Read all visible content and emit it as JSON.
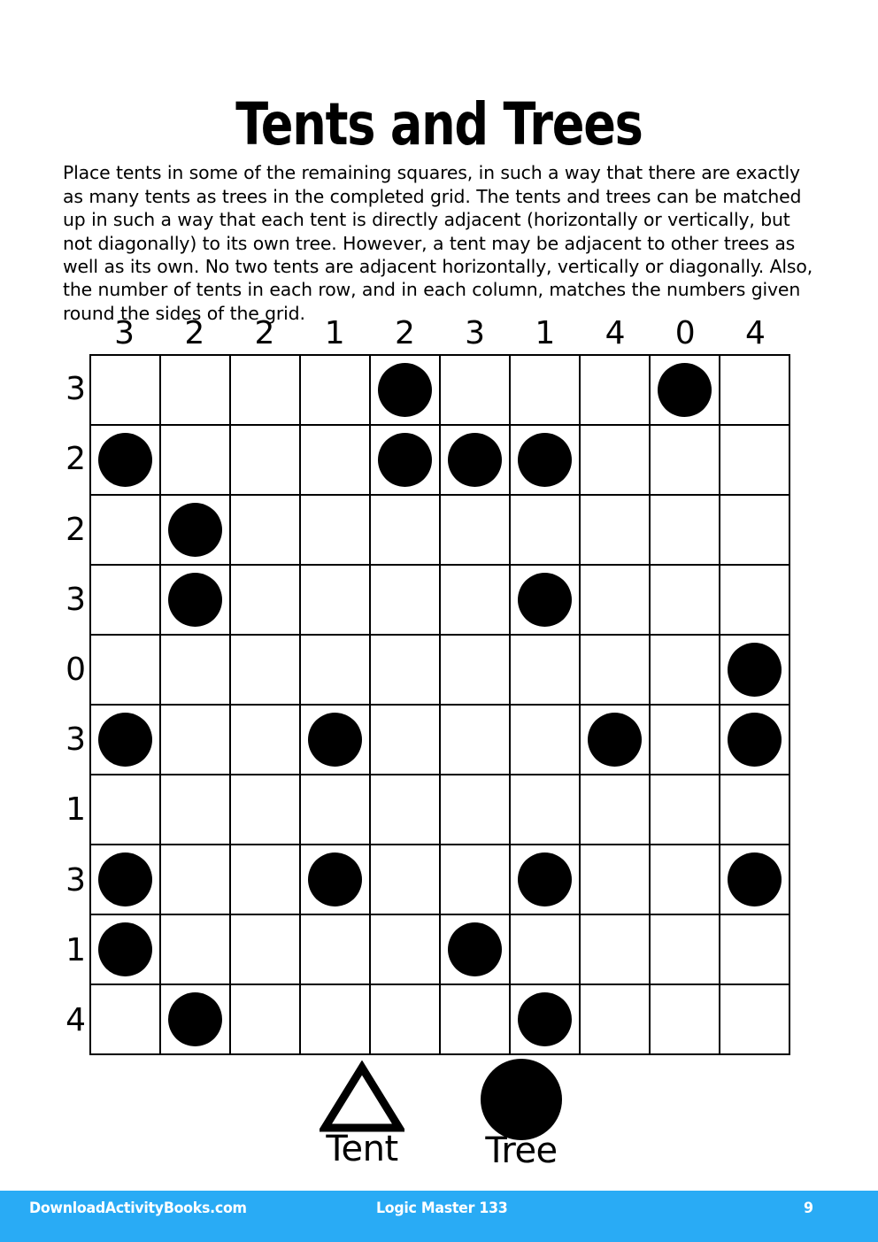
{
  "page": {
    "title": "Tents and Trees",
    "instructions": "Place tents in some of the remaining squares, in such a way that there are exactly as many tents as trees in the completed grid. The tents and trees can be matched up in such a way that each tent is directly adjacent (horizontally or vertically, but not diagonally) to its own tree. However, a tent may be adjacent to other trees as well as its own. No two tents are adjacent horizontally, vertically or diagonally. Also, the number of tents in each row, and in each column, matches the numbers given round the sides of the grid."
  },
  "puzzle": {
    "rows": 10,
    "cols": 10,
    "column_clues": [
      3,
      2,
      2,
      1,
      2,
      3,
      1,
      4,
      0,
      4
    ],
    "row_clues": [
      3,
      2,
      2,
      3,
      0,
      3,
      1,
      3,
      1,
      4
    ],
    "tree_symbol": "filled-circle",
    "tent_symbol": "outline-triangle",
    "grid": [
      [
        0,
        0,
        0,
        0,
        1,
        0,
        0,
        0,
        1,
        0
      ],
      [
        1,
        0,
        0,
        0,
        1,
        1,
        1,
        0,
        0,
        0
      ],
      [
        0,
        1,
        0,
        0,
        0,
        0,
        0,
        0,
        0,
        0
      ],
      [
        0,
        1,
        0,
        0,
        0,
        0,
        1,
        0,
        0,
        0
      ],
      [
        0,
        0,
        0,
        0,
        0,
        0,
        0,
        0,
        0,
        1
      ],
      [
        1,
        0,
        0,
        1,
        0,
        0,
        0,
        1,
        0,
        1
      ],
      [
        0,
        0,
        0,
        0,
        0,
        0,
        0,
        0,
        0,
        0
      ],
      [
        1,
        0,
        0,
        1,
        0,
        0,
        1,
        0,
        0,
        1
      ],
      [
        1,
        0,
        0,
        0,
        0,
        1,
        0,
        0,
        0,
        0
      ],
      [
        0,
        1,
        0,
        0,
        0,
        0,
        1,
        0,
        0,
        0
      ]
    ]
  },
  "legend": {
    "tent": {
      "label": "Tent",
      "icon": "triangle-outline-icon"
    },
    "tree": {
      "label": "Tree",
      "icon": "circle-filled-icon"
    }
  },
  "footer": {
    "site": "DownloadActivityBooks.com",
    "book": "Logic Master 133",
    "page_number": "9",
    "background_color": "#29ABF5",
    "text_color": "#ffffff"
  }
}
